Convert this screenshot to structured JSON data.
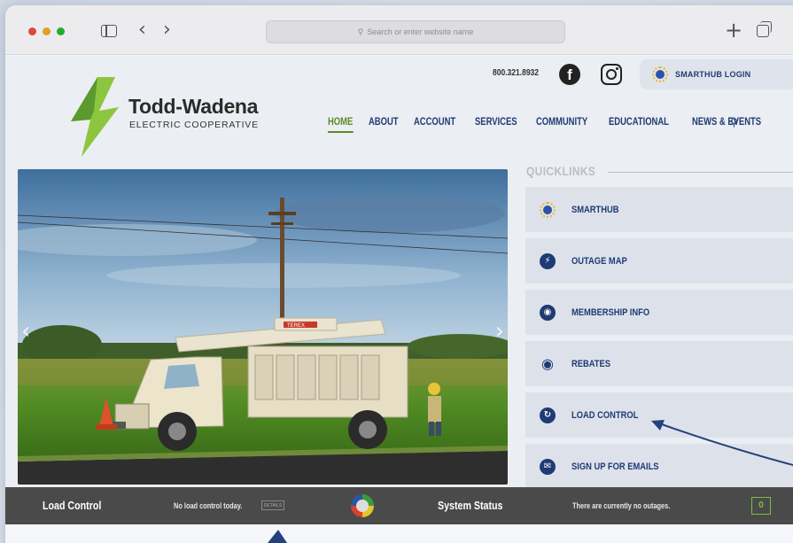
{
  "browser": {
    "address_placeholder": "Search or enter website name",
    "new_tab_symbol": "+",
    "back_symbol": "‹",
    "forward_symbol": "›"
  },
  "header": {
    "phone": "800.321.8932",
    "facebook_glyph": "f",
    "smarthub_login": "SMARTHUB LOGIN"
  },
  "brand": {
    "name": "Todd-Wadena",
    "subtitle": "ELECTRIC COOPERATIVE",
    "colors": {
      "bolt_light": "#8cc63f",
      "bolt_dark": "#3f7d2a"
    }
  },
  "nav": {
    "items": [
      "HOME",
      "ABOUT",
      "ACCOUNT",
      "SERVICES",
      "COMMUNITY",
      "EDUCATIONAL",
      "NEWS & EVENTS"
    ],
    "active": "HOME",
    "search_icon": "search-icon"
  },
  "hero": {
    "prev_symbol": "‹",
    "next_symbol": "›",
    "truck_brand": "TEREX"
  },
  "quicklinks": {
    "title": "QUICKLINKS",
    "items": [
      {
        "label": "SMARTHUB",
        "icon": "smarthub-icon"
      },
      {
        "label": "OUTAGE MAP",
        "icon": "lightning-icon"
      },
      {
        "label": "MEMBERSHIP INFO",
        "icon": "podcast-icon"
      },
      {
        "label": "REBATES",
        "icon": "piggy-bank-icon"
      },
      {
        "label": "LOAD CONTROL",
        "icon": "refresh-icon"
      },
      {
        "label": "SIGN UP FOR EMAILS",
        "icon": "email-icon"
      }
    ]
  },
  "status": {
    "load_title": "Load Control",
    "load_message": "No load control today.",
    "details_label": "DETAILS",
    "system_title": "System Status",
    "system_message": "There are currently no outages.",
    "outage_count": "0"
  },
  "colors": {
    "nav_blue": "#1f3b74",
    "active_green": "#5d8a2a",
    "status_bar": "#4a4a4a",
    "annotation_arrow": "#24407e"
  }
}
